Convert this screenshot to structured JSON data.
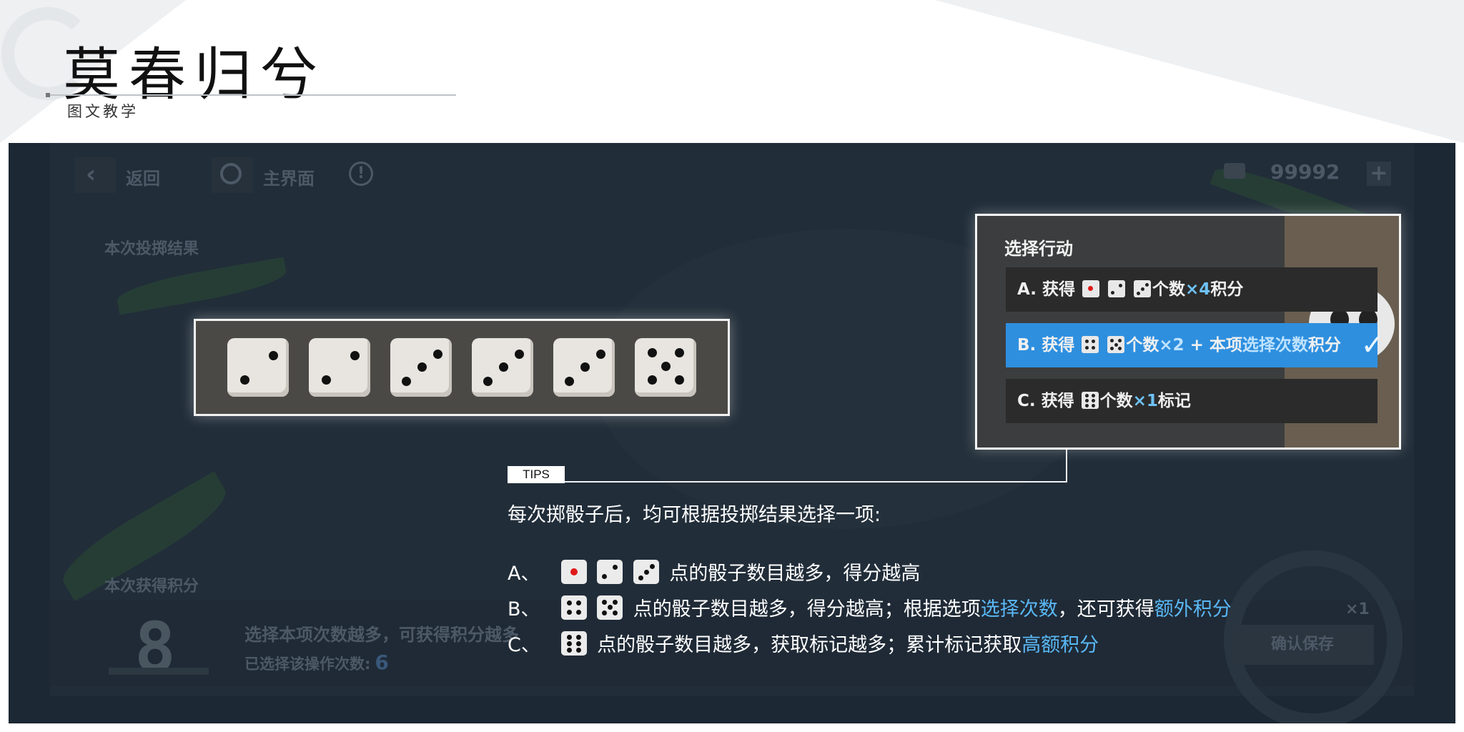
{
  "header": {
    "title": "莫春归兮",
    "subtitle": "图文教学"
  },
  "topbar": {
    "back_label": "返回",
    "home_label": "主界面",
    "info_icon": "info-icon",
    "coins": "99992",
    "plus": "+"
  },
  "result_section": {
    "label": "本次投掷结果",
    "dice": [
      2,
      2,
      3,
      3,
      3,
      5
    ]
  },
  "action_card": {
    "title": "选择行动",
    "options": [
      {
        "prefix": "A. 获得",
        "suffix": "个数",
        "mult": "×4",
        "tail": "积分"
      },
      {
        "prefix": "B. 获得",
        "suffix": "个数",
        "mult": "×2",
        "mid": " + 本项",
        "hl2": "选择次数",
        "tail": "积分"
      },
      {
        "prefix": "C. 获得",
        "suffix": "个数",
        "mult": "×1",
        "tail": "标记"
      }
    ],
    "selected_index": 1
  },
  "score_section": {
    "label": "本次获得积分",
    "score": "8",
    "description": "选择本项次数越多，可获得积分越多",
    "times_label": "已选择该操作次数:",
    "times_value": "6",
    "confirm": "确认保存",
    "badge": "×1"
  },
  "tips": {
    "tag": "TIPS",
    "intro": "每次掷骰子后，均可根据投掷结果选择一项:",
    "a": {
      "prefix": "A、",
      "text": "点的骰子数目越多，得分越高"
    },
    "b": {
      "prefix": "B、",
      "text1": "点的骰子数目越多，得分越高；根据选项",
      "hl1": "选择次数",
      "text2": "，还可获得",
      "hl2": "额外积分"
    },
    "c": {
      "prefix": "C、",
      "text1": "点的骰子数目越多，获取标记越多；累计标记获取",
      "hl1": "高额积分"
    }
  },
  "colors": {
    "panel_bg": "#1c2833",
    "selected_option": "#2e8fdf",
    "highlight_blue": "#5ab8f5"
  }
}
